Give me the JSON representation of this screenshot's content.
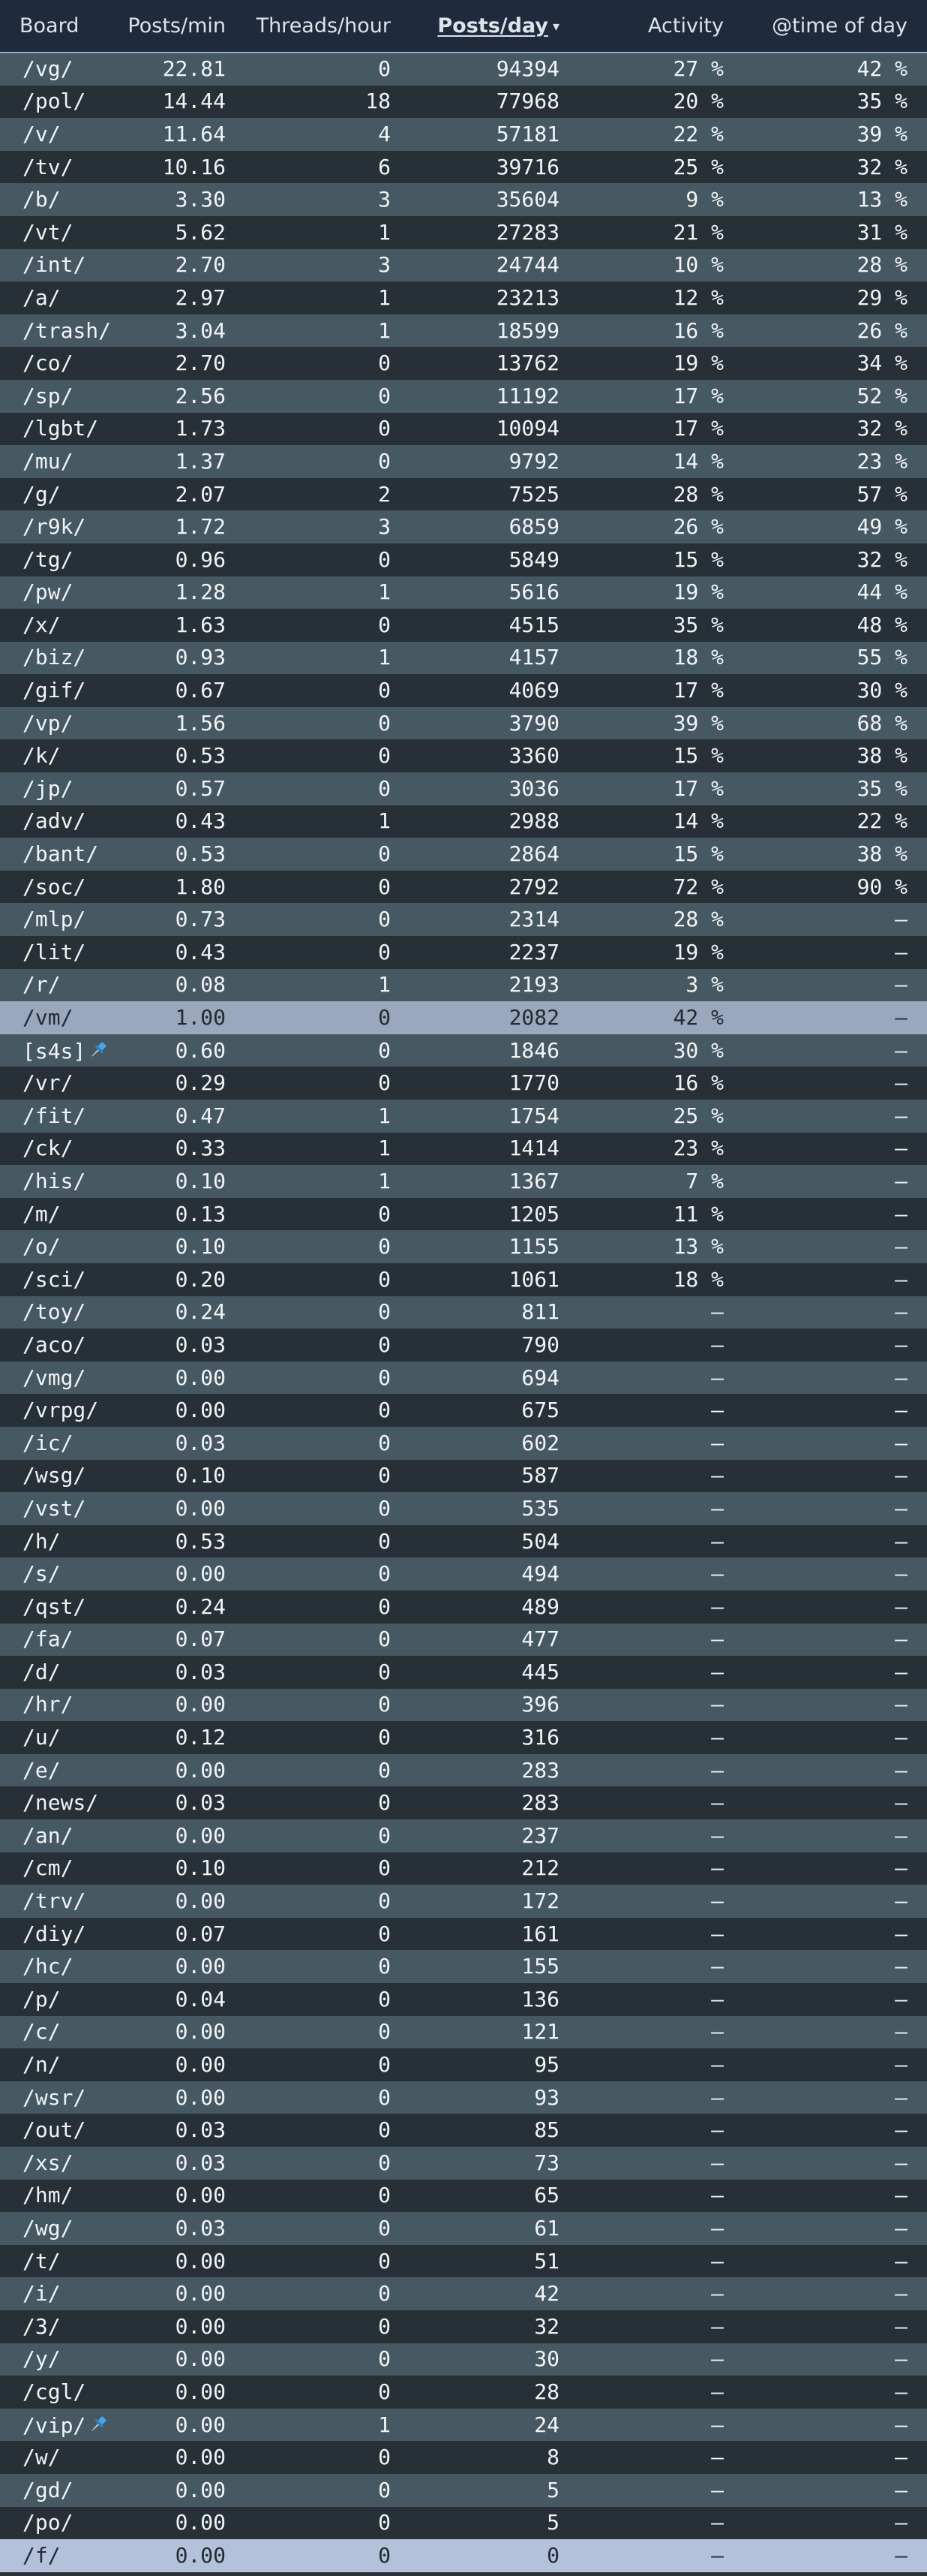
{
  "headers": {
    "board": "Board",
    "posts_min": "Posts/min",
    "threads_hour": "Threads/hour",
    "posts_day": "Posts/day",
    "activity": "Activity",
    "time_of_day": "@time of day"
  },
  "sort": {
    "column": "posts_day",
    "direction": "desc",
    "caret": "▾"
  },
  "colors": {
    "header_bg": "#1f2a3d",
    "row_odd": "#465861",
    "row_even": "#263036",
    "highlight_vm": "#9aa8bd",
    "highlight_f": "#b3c1da",
    "pin": "#4aa3e6"
  },
  "rows": [
    {
      "board": "/vg/",
      "ppm": "22.81",
      "tph": "0",
      "ppd": "94394",
      "act": "27 %",
      "tod": "42 %"
    },
    {
      "board": "/pol/",
      "ppm": "14.44",
      "tph": "18",
      "ppd": "77968",
      "act": "20 %",
      "tod": "35 %"
    },
    {
      "board": "/v/",
      "ppm": "11.64",
      "tph": "4",
      "ppd": "57181",
      "act": "22 %",
      "tod": "39 %"
    },
    {
      "board": "/tv/",
      "ppm": "10.16",
      "tph": "6",
      "ppd": "39716",
      "act": "25 %",
      "tod": "32 %"
    },
    {
      "board": "/b/",
      "ppm": "3.30",
      "tph": "3",
      "ppd": "35604",
      "act": "9 %",
      "tod": "13 %"
    },
    {
      "board": "/vt/",
      "ppm": "5.62",
      "tph": "1",
      "ppd": "27283",
      "act": "21 %",
      "tod": "31 %"
    },
    {
      "board": "/int/",
      "ppm": "2.70",
      "tph": "3",
      "ppd": "24744",
      "act": "10 %",
      "tod": "28 %"
    },
    {
      "board": "/a/",
      "ppm": "2.97",
      "tph": "1",
      "ppd": "23213",
      "act": "12 %",
      "tod": "29 %"
    },
    {
      "board": "/trash/",
      "ppm": "3.04",
      "tph": "1",
      "ppd": "18599",
      "act": "16 %",
      "tod": "26 %"
    },
    {
      "board": "/co/",
      "ppm": "2.70",
      "tph": "0",
      "ppd": "13762",
      "act": "19 %",
      "tod": "34 %"
    },
    {
      "board": "/sp/",
      "ppm": "2.56",
      "tph": "0",
      "ppd": "11192",
      "act": "17 %",
      "tod": "52 %"
    },
    {
      "board": "/lgbt/",
      "ppm": "1.73",
      "tph": "0",
      "ppd": "10094",
      "act": "17 %",
      "tod": "32 %"
    },
    {
      "board": "/mu/",
      "ppm": "1.37",
      "tph": "0",
      "ppd": "9792",
      "act": "14 %",
      "tod": "23 %"
    },
    {
      "board": "/g/",
      "ppm": "2.07",
      "tph": "2",
      "ppd": "7525",
      "act": "28 %",
      "tod": "57 %"
    },
    {
      "board": "/r9k/",
      "ppm": "1.72",
      "tph": "3",
      "ppd": "6859",
      "act": "26 %",
      "tod": "49 %"
    },
    {
      "board": "/tg/",
      "ppm": "0.96",
      "tph": "0",
      "ppd": "5849",
      "act": "15 %",
      "tod": "32 %"
    },
    {
      "board": "/pw/",
      "ppm": "1.28",
      "tph": "1",
      "ppd": "5616",
      "act": "19 %",
      "tod": "44 %"
    },
    {
      "board": "/x/",
      "ppm": "1.63",
      "tph": "0",
      "ppd": "4515",
      "act": "35 %",
      "tod": "48 %"
    },
    {
      "board": "/biz/",
      "ppm": "0.93",
      "tph": "1",
      "ppd": "4157",
      "act": "18 %",
      "tod": "55 %"
    },
    {
      "board": "/gif/",
      "ppm": "0.67",
      "tph": "0",
      "ppd": "4069",
      "act": "17 %",
      "tod": "30 %"
    },
    {
      "board": "/vp/",
      "ppm": "1.56",
      "tph": "0",
      "ppd": "3790",
      "act": "39 %",
      "tod": "68 %"
    },
    {
      "board": "/k/",
      "ppm": "0.53",
      "tph": "0",
      "ppd": "3360",
      "act": "15 %",
      "tod": "38 %"
    },
    {
      "board": "/jp/",
      "ppm": "0.57",
      "tph": "0",
      "ppd": "3036",
      "act": "17 %",
      "tod": "35 %"
    },
    {
      "board": "/adv/",
      "ppm": "0.43",
      "tph": "1",
      "ppd": "2988",
      "act": "14 %",
      "tod": "22 %"
    },
    {
      "board": "/bant/",
      "ppm": "0.53",
      "tph": "0",
      "ppd": "2864",
      "act": "15 %",
      "tod": "38 %"
    },
    {
      "board": "/soc/",
      "ppm": "1.80",
      "tph": "0",
      "ppd": "2792",
      "act": "72 %",
      "tod": "90 %"
    },
    {
      "board": "/mlp/",
      "ppm": "0.73",
      "tph": "0",
      "ppd": "2314",
      "act": "28 %",
      "tod": "–"
    },
    {
      "board": "/lit/",
      "ppm": "0.43",
      "tph": "0",
      "ppd": "2237",
      "act": "19 %",
      "tod": "–"
    },
    {
      "board": "/r/",
      "ppm": "0.08",
      "tph": "1",
      "ppd": "2193",
      "act": "3 %",
      "tod": "–"
    },
    {
      "board": "/vm/",
      "ppm": "1.00",
      "tph": "0",
      "ppd": "2082",
      "act": "42 %",
      "tod": "–",
      "highlight": "vm"
    },
    {
      "board": "[s4s]",
      "ppm": "0.60",
      "tph": "0",
      "ppd": "1846",
      "act": "30 %",
      "tod": "–",
      "pinned": true
    },
    {
      "board": "/vr/",
      "ppm": "0.29",
      "tph": "0",
      "ppd": "1770",
      "act": "16 %",
      "tod": "–"
    },
    {
      "board": "/fit/",
      "ppm": "0.47",
      "tph": "1",
      "ppd": "1754",
      "act": "25 %",
      "tod": "–"
    },
    {
      "board": "/ck/",
      "ppm": "0.33",
      "tph": "1",
      "ppd": "1414",
      "act": "23 %",
      "tod": "–"
    },
    {
      "board": "/his/",
      "ppm": "0.10",
      "tph": "1",
      "ppd": "1367",
      "act": "7 %",
      "tod": "–"
    },
    {
      "board": "/m/",
      "ppm": "0.13",
      "tph": "0",
      "ppd": "1205",
      "act": "11 %",
      "tod": "–"
    },
    {
      "board": "/o/",
      "ppm": "0.10",
      "tph": "0",
      "ppd": "1155",
      "act": "13 %",
      "tod": "–"
    },
    {
      "board": "/sci/",
      "ppm": "0.20",
      "tph": "0",
      "ppd": "1061",
      "act": "18 %",
      "tod": "–"
    },
    {
      "board": "/toy/",
      "ppm": "0.24",
      "tph": "0",
      "ppd": "811",
      "act": "–",
      "tod": "–"
    },
    {
      "board": "/aco/",
      "ppm": "0.03",
      "tph": "0",
      "ppd": "790",
      "act": "–",
      "tod": "–"
    },
    {
      "board": "/vmg/",
      "ppm": "0.00",
      "tph": "0",
      "ppd": "694",
      "act": "–",
      "tod": "–"
    },
    {
      "board": "/vrpg/",
      "ppm": "0.00",
      "tph": "0",
      "ppd": "675",
      "act": "–",
      "tod": "–"
    },
    {
      "board": "/ic/",
      "ppm": "0.03",
      "tph": "0",
      "ppd": "602",
      "act": "–",
      "tod": "–"
    },
    {
      "board": "/wsg/",
      "ppm": "0.10",
      "tph": "0",
      "ppd": "587",
      "act": "–",
      "tod": "–"
    },
    {
      "board": "/vst/",
      "ppm": "0.00",
      "tph": "0",
      "ppd": "535",
      "act": "–",
      "tod": "–"
    },
    {
      "board": "/h/",
      "ppm": "0.53",
      "tph": "0",
      "ppd": "504",
      "act": "–",
      "tod": "–"
    },
    {
      "board": "/s/",
      "ppm": "0.00",
      "tph": "0",
      "ppd": "494",
      "act": "–",
      "tod": "–"
    },
    {
      "board": "/qst/",
      "ppm": "0.24",
      "tph": "0",
      "ppd": "489",
      "act": "–",
      "tod": "–"
    },
    {
      "board": "/fa/",
      "ppm": "0.07",
      "tph": "0",
      "ppd": "477",
      "act": "–",
      "tod": "–"
    },
    {
      "board": "/d/",
      "ppm": "0.03",
      "tph": "0",
      "ppd": "445",
      "act": "–",
      "tod": "–"
    },
    {
      "board": "/hr/",
      "ppm": "0.00",
      "tph": "0",
      "ppd": "396",
      "act": "–",
      "tod": "–"
    },
    {
      "board": "/u/",
      "ppm": "0.12",
      "tph": "0",
      "ppd": "316",
      "act": "–",
      "tod": "–"
    },
    {
      "board": "/e/",
      "ppm": "0.00",
      "tph": "0",
      "ppd": "283",
      "act": "–",
      "tod": "–"
    },
    {
      "board": "/news/",
      "ppm": "0.03",
      "tph": "0",
      "ppd": "283",
      "act": "–",
      "tod": "–"
    },
    {
      "board": "/an/",
      "ppm": "0.00",
      "tph": "0",
      "ppd": "237",
      "act": "–",
      "tod": "–"
    },
    {
      "board": "/cm/",
      "ppm": "0.10",
      "tph": "0",
      "ppd": "212",
      "act": "–",
      "tod": "–"
    },
    {
      "board": "/trv/",
      "ppm": "0.00",
      "tph": "0",
      "ppd": "172",
      "act": "–",
      "tod": "–"
    },
    {
      "board": "/diy/",
      "ppm": "0.07",
      "tph": "0",
      "ppd": "161",
      "act": "–",
      "tod": "–"
    },
    {
      "board": "/hc/",
      "ppm": "0.00",
      "tph": "0",
      "ppd": "155",
      "act": "–",
      "tod": "–"
    },
    {
      "board": "/p/",
      "ppm": "0.04",
      "tph": "0",
      "ppd": "136",
      "act": "–",
      "tod": "–"
    },
    {
      "board": "/c/",
      "ppm": "0.00",
      "tph": "0",
      "ppd": "121",
      "act": "–",
      "tod": "–"
    },
    {
      "board": "/n/",
      "ppm": "0.00",
      "tph": "0",
      "ppd": "95",
      "act": "–",
      "tod": "–"
    },
    {
      "board": "/wsr/",
      "ppm": "0.00",
      "tph": "0",
      "ppd": "93",
      "act": "–",
      "tod": "–"
    },
    {
      "board": "/out/",
      "ppm": "0.03",
      "tph": "0",
      "ppd": "85",
      "act": "–",
      "tod": "–"
    },
    {
      "board": "/xs/",
      "ppm": "0.03",
      "tph": "0",
      "ppd": "73",
      "act": "–",
      "tod": "–"
    },
    {
      "board": "/hm/",
      "ppm": "0.00",
      "tph": "0",
      "ppd": "65",
      "act": "–",
      "tod": "–"
    },
    {
      "board": "/wg/",
      "ppm": "0.03",
      "tph": "0",
      "ppd": "61",
      "act": "–",
      "tod": "–"
    },
    {
      "board": "/t/",
      "ppm": "0.00",
      "tph": "0",
      "ppd": "51",
      "act": "–",
      "tod": "–"
    },
    {
      "board": "/i/",
      "ppm": "0.00",
      "tph": "0",
      "ppd": "42",
      "act": "–",
      "tod": "–"
    },
    {
      "board": "/3/",
      "ppm": "0.00",
      "tph": "0",
      "ppd": "32",
      "act": "–",
      "tod": "–"
    },
    {
      "board": "/y/",
      "ppm": "0.00",
      "tph": "0",
      "ppd": "30",
      "act": "–",
      "tod": "–"
    },
    {
      "board": "/cgl/",
      "ppm": "0.00",
      "tph": "0",
      "ppd": "28",
      "act": "–",
      "tod": "–"
    },
    {
      "board": "/vip/",
      "ppm": "0.00",
      "tph": "1",
      "ppd": "24",
      "act": "–",
      "tod": "–",
      "pinned": true
    },
    {
      "board": "/w/",
      "ppm": "0.00",
      "tph": "0",
      "ppd": "8",
      "act": "–",
      "tod": "–"
    },
    {
      "board": "/gd/",
      "ppm": "0.00",
      "tph": "0",
      "ppd": "5",
      "act": "–",
      "tod": "–"
    },
    {
      "board": "/po/",
      "ppm": "0.00",
      "tph": "0",
      "ppd": "5",
      "act": "–",
      "tod": "–"
    },
    {
      "board": "/f/",
      "ppm": "0.00",
      "tph": "0",
      "ppd": "0",
      "act": "–",
      "tod": "–",
      "highlight": "f"
    }
  ]
}
